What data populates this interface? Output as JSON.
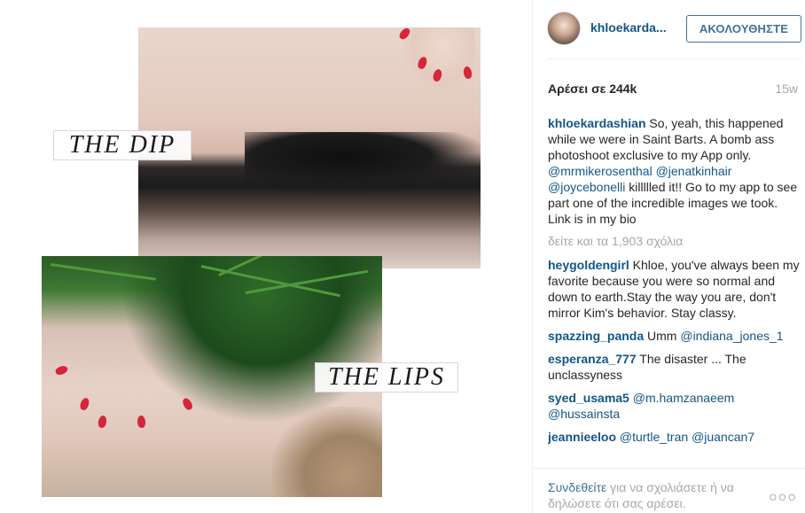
{
  "media": {
    "top_caption": "THE DIP",
    "bottom_caption": "THE LIPS"
  },
  "header": {
    "username": "khloekarda...",
    "follow_label": "ΑΚΟΛΟΥΘΗΣΤΕ"
  },
  "meta": {
    "likes": "Αρέσει σε 244k",
    "time": "15w"
  },
  "caption": {
    "user": "khloekardashian",
    "text_1": " So, yeah, this happened while we were in Saint Barts. A bomb ass photoshoot exclusive to my App only. ",
    "mention_1": "@mrmikerosenthal",
    "mention_2": "@jenatkinhair",
    "mention_3": "@joycebonelli",
    "text_2": " killllled it!! Go to my app to see part one of the incredible images we took. Link is in my bio"
  },
  "view_all": "δείτε και τα 1,903 σχόλια",
  "comments": [
    {
      "user": "heygoldengirl",
      "text": " Khloe, you've always been my favorite because you were so normal and down to earth.Stay the way you are, don't mirror Kim's behavior. Stay classy."
    },
    {
      "user": "spazzing_panda",
      "text": " Umm ",
      "mention": "@indiana_jones_1"
    },
    {
      "user": "esperanza_777",
      "text": " The disaster ... The unclassyness"
    },
    {
      "user": "syed_usama5",
      "text": " ",
      "mention": "@m.hamzanaeem",
      "mention_b": "@hussainsta"
    },
    {
      "user": "jeannieeloo",
      "text": " ",
      "mention": "@turtle_tran",
      "mention_b": "@juancan7"
    }
  ],
  "footer": {
    "login_link": "Συνδεθείτε",
    "login_text": " για να σχολιάσετε ή να δηλώσετε ότι σας αρέσει.",
    "more_label": "○○○"
  },
  "icons": {
    "more": "more-options-icon",
    "avatar": "profile-avatar"
  },
  "colors": {
    "link": "#125688",
    "button": "#3f729b",
    "muted": "#a5a7aa",
    "nail": "#d4263b"
  }
}
